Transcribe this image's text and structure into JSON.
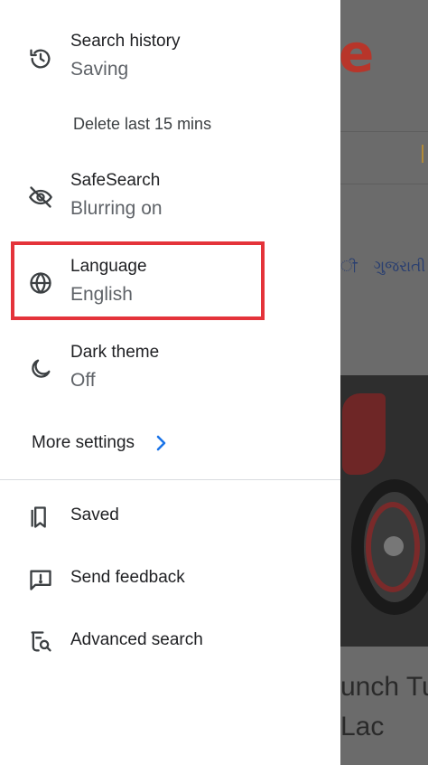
{
  "drawer": {
    "search_history": {
      "title": "Search history",
      "subtitle": "Saving",
      "icon": "history-icon"
    },
    "delete_last": "Delete last 15 mins",
    "safesearch": {
      "title": "SafeSearch",
      "subtitle": "Blurring on",
      "icon": "eye-off-icon"
    },
    "language": {
      "title": "Language",
      "subtitle": "English",
      "icon": "globe-icon"
    },
    "dark_theme": {
      "title": "Dark theme",
      "subtitle": "Off",
      "icon": "moon-icon"
    },
    "more_settings": "More settings",
    "saved": {
      "label": "Saved",
      "icon": "bookmark-icon"
    },
    "send_feedback": {
      "label": "Send feedback",
      "icon": "feedback-icon"
    },
    "advanced_search": {
      "label": "Advanced search",
      "icon": "advanced-search-icon"
    }
  },
  "background": {
    "logo_fragment": "e",
    "languages": [
      "ੀ",
      "ગુજરાતી"
    ],
    "headline_lines": [
      "unch Tu",
      "Lac"
    ]
  },
  "colors": {
    "highlight_border": "#e4333a",
    "chevron": "#1a73e8",
    "scrim": "#6b6b6b"
  }
}
